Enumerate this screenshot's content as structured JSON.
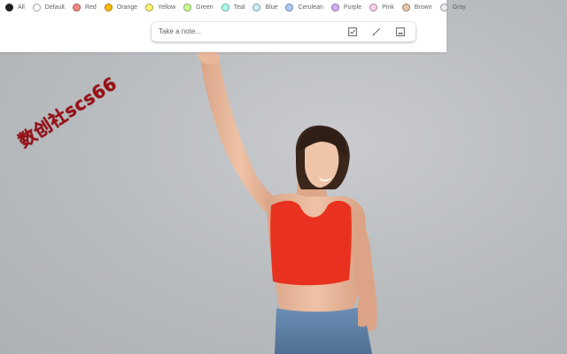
{
  "filters": [
    {
      "label": "All",
      "color": "#202124"
    },
    {
      "label": "Default",
      "color": "#ffffff"
    },
    {
      "label": "Red",
      "color": "#f28b82"
    },
    {
      "label": "Orange",
      "color": "#fbbc04"
    },
    {
      "label": "Yellow",
      "color": "#fff475"
    },
    {
      "label": "Green",
      "color": "#ccff90"
    },
    {
      "label": "Teal",
      "color": "#a7ffeb"
    },
    {
      "label": "Blue",
      "color": "#cbf0f8"
    },
    {
      "label": "Cerulean",
      "color": "#aecbfa"
    },
    {
      "label": "Purple",
      "color": "#d7aefb"
    },
    {
      "label": "Pink",
      "color": "#fdcfe8"
    },
    {
      "label": "Brown",
      "color": "#e6c9a8"
    },
    {
      "label": "Gray",
      "color": "#e8eaed"
    }
  ],
  "note": {
    "placeholder": "Take a note...",
    "icons": [
      "checkbox-icon",
      "brush-icon",
      "image-icon"
    ]
  },
  "watermark": "数创社scs66",
  "colors": {
    "panel": "#ffffff",
    "top_red": "#e8321f",
    "jeans": "#5b7fa6",
    "hair": "#3a261b",
    "skin": "#e9b89b"
  }
}
